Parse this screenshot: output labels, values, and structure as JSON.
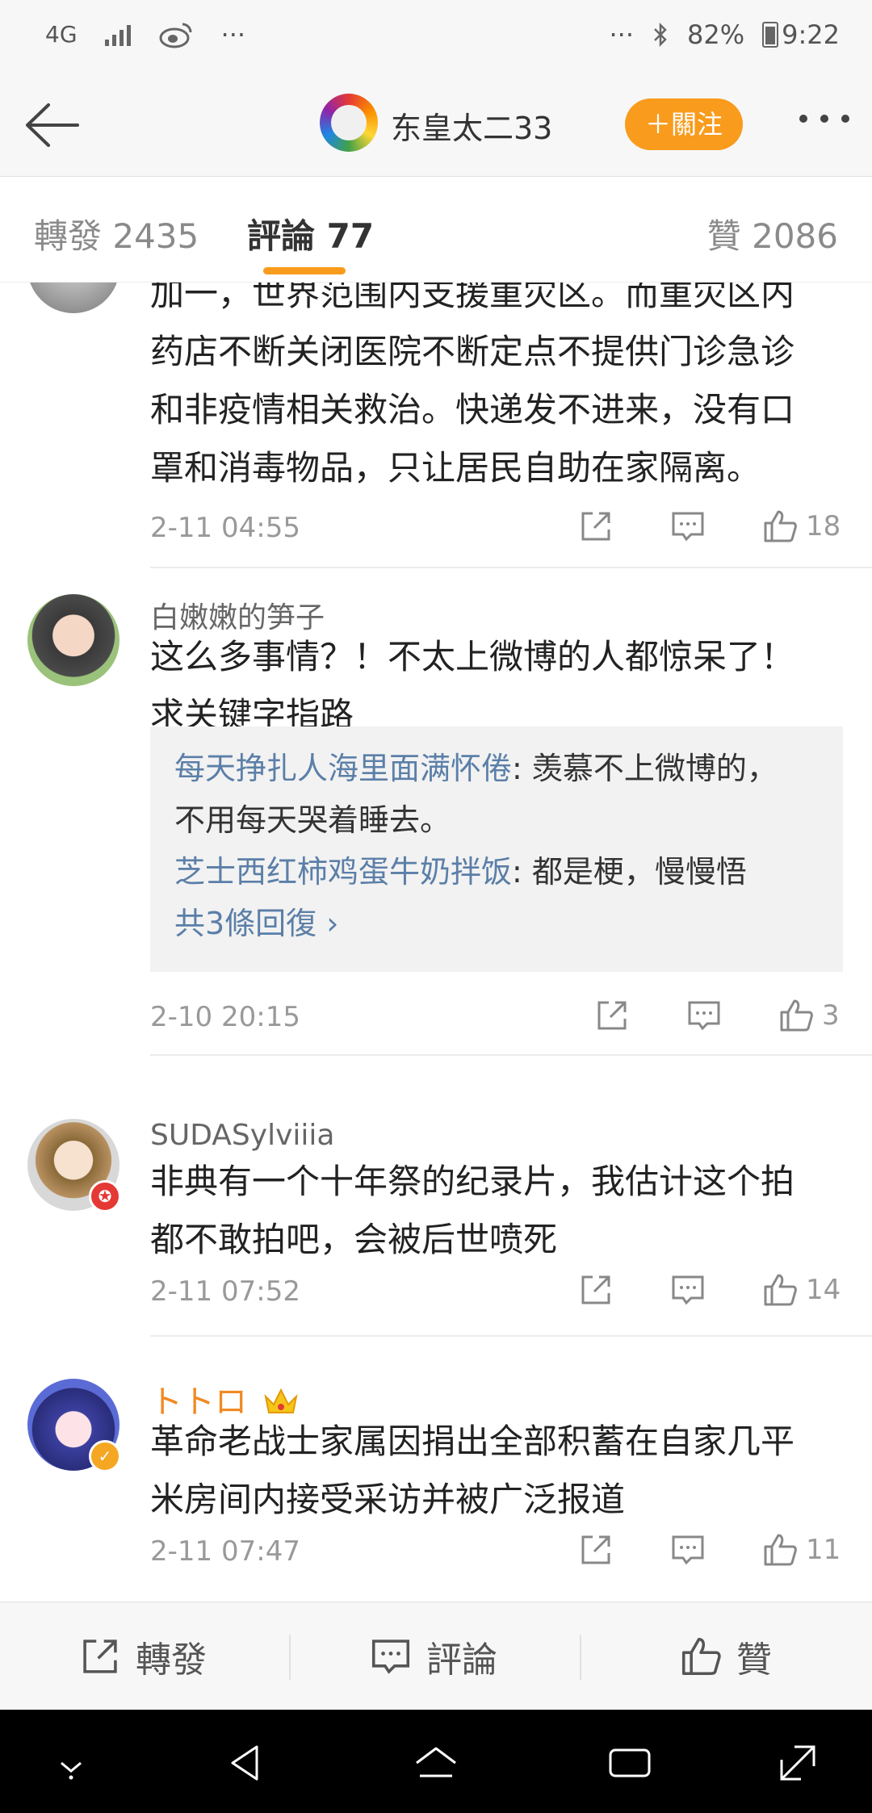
{
  "status_bar": {
    "network": "4G",
    "dots_left": "···",
    "dots_right": "···",
    "battery": "82%",
    "time": "9:22"
  },
  "header": {
    "username": "东皇太二33",
    "follow_label": "＋關注"
  },
  "tabs": [
    {
      "label": "轉發 2435"
    },
    {
      "label": "評論 77"
    },
    {
      "label": "贊 2086"
    }
  ],
  "comments": [
    {
      "text_lines": [
        "加一，世界范围内支援重灾区。而重灾区内",
        "药店不断关闭医院不断定点不提供门诊急诊",
        "和非疫情相关救治。快递发不进来，没有口",
        "罩和消毒物品，只让居民自助在家隔离。"
      ],
      "time": "2-11 04:55",
      "likes": "18"
    },
    {
      "name": "白嫩嫩的笋子",
      "text_lines": [
        "这么多事情？！不太上微博的人都惊呆了！",
        "求关键字指路"
      ],
      "replies": [
        {
          "name": "每天挣扎人海里面满怀倦",
          "text": ": 羡慕不上微博的，",
          "text2": "不用每天哭着睡去。"
        },
        {
          "name": "芝士西红柿鸡蛋牛奶拌饭",
          "text": ": 都是梗，慢慢悟"
        }
      ],
      "more_replies": "共3條回復 ›",
      "time": "2-10 20:15",
      "likes": "3"
    },
    {
      "name": "SUDASylviiia",
      "text_lines": [
        "非典有一个十年祭的纪录片，我估计这个拍",
        "都不敢拍吧，会被后世喷死"
      ],
      "time": "2-11 07:52",
      "likes": "14"
    },
    {
      "name": "トトロ",
      "text_lines": [
        "革命老战士家属因捐出全部积蓄在自家几平",
        "米房间内接受采访并被广泛报道"
      ],
      "time": "2-11 07:47",
      "likes": "11"
    }
  ],
  "bottom_bar": {
    "repost": "轉發",
    "comment": "評論",
    "like": "贊"
  },
  "colors": {
    "accent": "#f99b1c",
    "link": "#5b7fa8",
    "vip_name": "#f08a24"
  }
}
